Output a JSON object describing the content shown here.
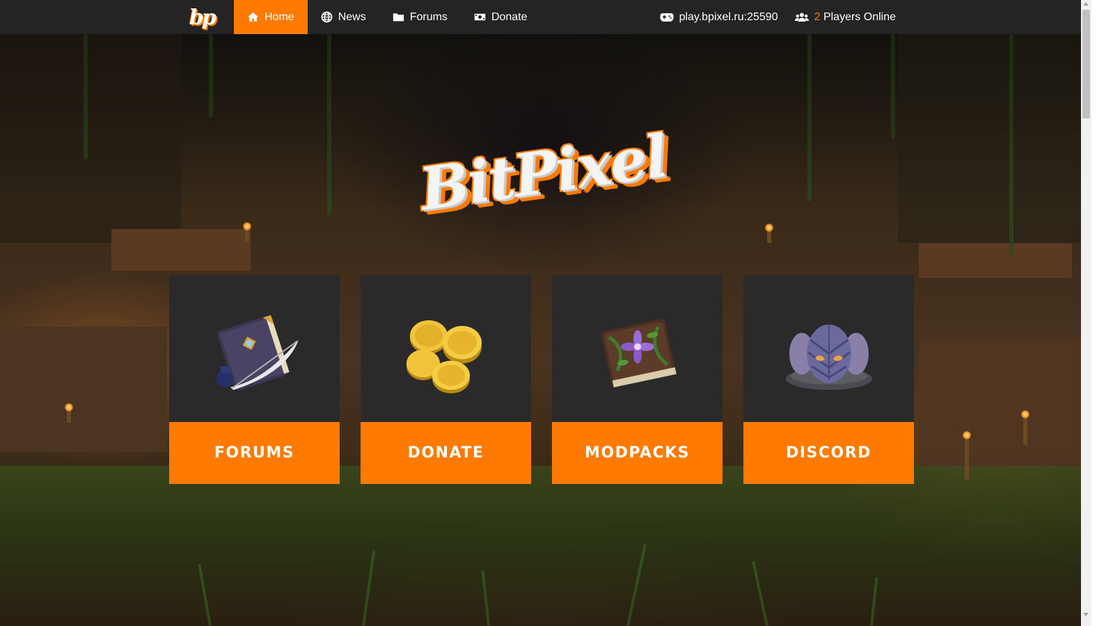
{
  "nav": {
    "logo_text": "bp",
    "items": [
      {
        "label": "Home",
        "icon": "home-icon",
        "active": true
      },
      {
        "label": "News",
        "icon": "globe-icon",
        "active": false
      },
      {
        "label": "Forums",
        "icon": "folder-icon",
        "active": false
      },
      {
        "label": "Donate",
        "icon": "money-icon",
        "active": false
      }
    ],
    "server_address": "play.bpixel.ru:25590",
    "players_count": "2",
    "players_label": "Players Online"
  },
  "hero": {
    "brand_name": "BitPixel"
  },
  "cards": [
    {
      "label": "FORUMS",
      "icon": "book-quill-icon"
    },
    {
      "label": "DONATE",
      "icon": "gold-coins-icon"
    },
    {
      "label": "MODPACKS",
      "icon": "flower-book-icon"
    },
    {
      "label": "DISCORD",
      "icon": "dragon-egg-icon"
    }
  ],
  "colors": {
    "accent": "#ff7a00",
    "navbar": "#242424",
    "card_bg": "#2a2a2a"
  }
}
